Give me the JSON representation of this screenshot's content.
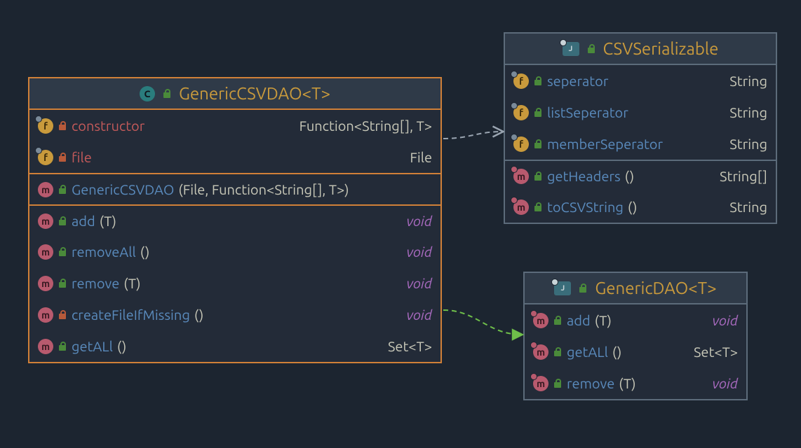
{
  "classes": {
    "genericCsvDao": {
      "title": "GenericCSVDAO<T>",
      "fields": [
        {
          "name": "constructor",
          "type": "Function<String[], T>",
          "vis": "red"
        },
        {
          "name": "file",
          "type": "File",
          "vis": "red"
        }
      ],
      "constructor": {
        "sig": "GenericCSVDAO",
        "params": "(File, Function<String[], T>)"
      },
      "methods": [
        {
          "name": "add",
          "params": "(T)",
          "ret": "void",
          "vis": "green"
        },
        {
          "name": "removeAll",
          "params": "()",
          "ret": "void",
          "vis": "green"
        },
        {
          "name": "remove",
          "params": "(T)",
          "ret": "void",
          "vis": "green"
        },
        {
          "name": "createFileIfMissing",
          "params": "()",
          "ret": "void",
          "vis": "red"
        },
        {
          "name": "getALl",
          "params": "()",
          "ret": "Set<T>",
          "vis": "green"
        }
      ]
    },
    "csvSerializable": {
      "title": "CSVSerializable",
      "fields": [
        {
          "name": "seperator",
          "type": "String"
        },
        {
          "name": "listSeperator",
          "type": "String"
        },
        {
          "name": "memberSeperator",
          "type": "String"
        }
      ],
      "methods": [
        {
          "name": "getHeaders",
          "params": "()",
          "ret": "String[]"
        },
        {
          "name": "toCSVString",
          "params": "()",
          "ret": "String"
        }
      ]
    },
    "genericDao": {
      "title": "GenericDAO<T>",
      "methods": [
        {
          "name": "add",
          "params": "(T)",
          "ret": "void"
        },
        {
          "name": "getALl",
          "params": "()",
          "ret": "Set<T>"
        },
        {
          "name": "remove",
          "params": "(T)",
          "ret": "void"
        }
      ]
    }
  }
}
